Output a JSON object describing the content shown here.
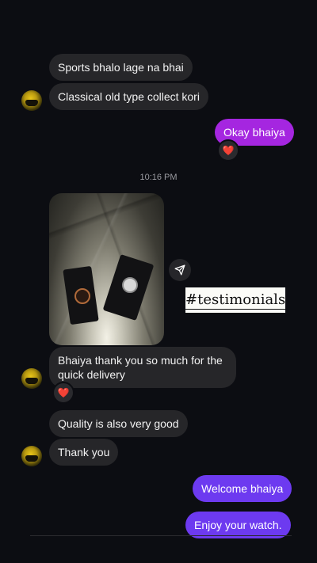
{
  "messages": {
    "m1": "Sports bhalo lage na bhai",
    "m2": "Classical old type collect kori",
    "m3": "Okay bhaiya",
    "m5": "Bhaiya thank you so much for the\nquick delivery",
    "m6": "Quality is also very good",
    "m7": "Thank you",
    "m8": "Welcome bhaiya",
    "m9": "Enjoy your watch."
  },
  "timestamp": "10:16 PM",
  "overlay_tag": "#testimonials",
  "reactions": {
    "r1": "❤️",
    "r2": "❤️"
  },
  "colors": {
    "background": "#0c0d12",
    "incoming_bubble": "#262629",
    "outgoing_purple": "#a526e0",
    "outgoing_blue": "#6d3af0"
  },
  "icons": {
    "share": "share-arrow-icon",
    "avatar": "user-avatar"
  }
}
